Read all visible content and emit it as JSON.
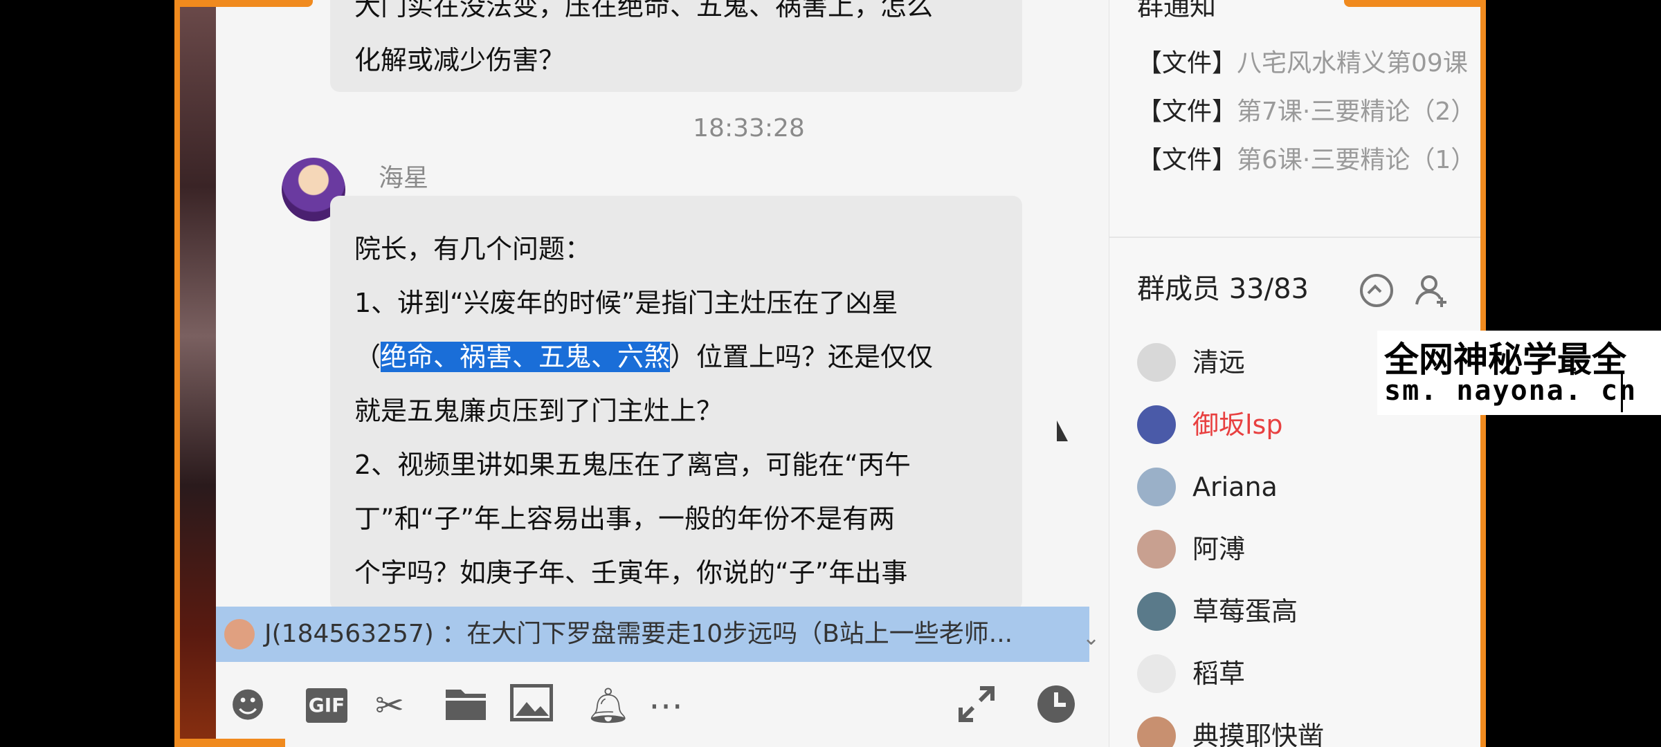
{
  "chat": {
    "previous_message": [
      "大门实在没法变，压在绝命、五鬼、祸害上，怎么",
      "化解或减少伤害？"
    ],
    "timestamp": "18:33:28",
    "sender": "海星",
    "message": {
      "line1": "院长，有几个问题：",
      "line2": "1、讲到“兴废年的时候”是指门主灶压在了凶星",
      "line3_pre": "（",
      "line3_selected": "绝命、祸害、五鬼、六煞",
      "line3_post": "）位置上吗？还是仅仅",
      "line4": "就是五鬼廉贞压到了门主灶上？",
      "line5": "2、视频里讲如果五鬼压在了离宫，可能在“丙午",
      "line6": "丁”和“子”年上容易出事，一般的年份不是有两",
      "line7": "个字吗？如庚子年、壬寅年，你说的“子”年出事"
    }
  },
  "notice_bar": {
    "text": "J(184563257) ：在大门下罗盘需要走10步远吗（B站上一些老师..."
  },
  "toolbar": {
    "gif_label": "GIF",
    "icons": [
      "emoji-icon",
      "gif-icon",
      "scissors-icon",
      "folder-icon",
      "image-icon",
      "bell-icon",
      "more-icon",
      "expand-icon",
      "clock-icon"
    ]
  },
  "panel": {
    "notice_title": "群通知",
    "files": [
      {
        "tag": "【文件】",
        "name": "八宅风水精义第09课"
      },
      {
        "tag": "【文件】",
        "name": "第7课·三要精论（2）"
      },
      {
        "tag": "【文件】",
        "name": "第6课·三要精论（1）"
      }
    ],
    "members_title": "群成员 33/83",
    "members": [
      {
        "name": "清远",
        "color": "#d8d8d8"
      },
      {
        "name": "御坂lsp",
        "color": "#4a5aa8"
      },
      {
        "name": "Ariana",
        "color": "#9ab0c8"
      },
      {
        "name": "阿溥",
        "color": "#c8a090"
      },
      {
        "name": "草莓蛋高",
        "color": "#5a7a8a"
      },
      {
        "name": "稻草",
        "color": "#e8e8e8"
      },
      {
        "name": "典摸耶快凿",
        "color": "#c89070"
      }
    ]
  },
  "watermark": {
    "line1": "全网神秘学最全",
    "line2": "sm. nayona. cn"
  },
  "colors": {
    "frame": "#f08a1e",
    "selection": "#1a6ed8",
    "notice_bar": "#a8c8ec"
  }
}
